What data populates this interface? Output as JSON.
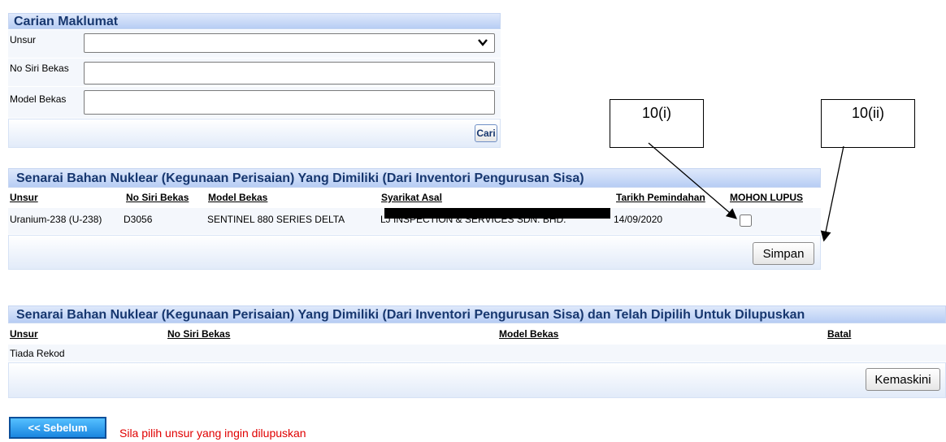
{
  "search": {
    "title": "Carian Maklumat",
    "unsur_label": "Unsur",
    "unsur_value": "",
    "no_siri_label": "No Siri Bekas",
    "no_siri_value": "",
    "model_label": "Model Bekas",
    "model_value": "",
    "cari_button": "Cari"
  },
  "callouts": {
    "first": "10(i)",
    "second": "10(ii)"
  },
  "owned_table": {
    "title": "Senarai Bahan Nuklear (Kegunaan Perisaian) Yang Dimiliki (Dari Inventori Pengurusan Sisa)",
    "headers": [
      "Unsur",
      "No Siri Bekas",
      "Model Bekas",
      "Syarikat Asal",
      "Tarikh Pemindahan",
      "MOHON LUPUS"
    ],
    "rows": [
      {
        "unsur": "Uranium-238 (U-238)",
        "no_siri": "D3056",
        "model": "SENTINEL 880 SERIES DELTA",
        "syarikat": "LJ INSPECTION & SERVICES SDN. BHD.",
        "tarikh": "14/09/2020",
        "mohon_lupus_checked": false
      }
    ],
    "save_button": "Simpan"
  },
  "selected_table": {
    "title": "Senarai Bahan Nuklear (Kegunaan Perisaian) Yang Dimiliki (Dari Inventori Pengurusan Sisa) dan Telah Dipilih Untuk Dilupuskan",
    "headers": [
      "Unsur",
      "No Siri Bekas",
      "Model Bekas",
      "Batal"
    ],
    "empty_text": "Tiada Rekod",
    "update_button": "Kemaskini"
  },
  "back_button": "<< Sebelum",
  "message": "Sila pilih unsur yang ingin dilupuskan",
  "colors": {
    "header_text": "#17376f",
    "message": "#e00000",
    "back_button": "#1e90e6"
  }
}
